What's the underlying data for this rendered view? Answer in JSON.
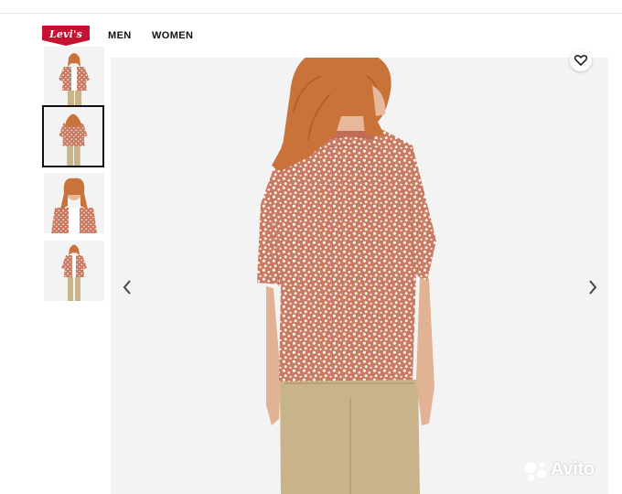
{
  "header": {
    "logo_text": "Levi's",
    "nav": [
      "MEN",
      "WOMEN"
    ]
  },
  "gallery": {
    "thumbnails": [
      {
        "view": "front-open",
        "selected": false
      },
      {
        "view": "back",
        "selected": true
      },
      {
        "view": "front-close",
        "selected": false
      },
      {
        "view": "full-front",
        "selected": false
      }
    ],
    "main_view": "back",
    "prev_icon": "chevron-left-icon",
    "next_icon": "chevron-right-icon",
    "favorite_icon": "heart-icon"
  },
  "watermark": {
    "text": "Avito"
  },
  "colors": {
    "brand_red": "#c41230",
    "shirt": "#c87a62",
    "dots": "#fbf2ea",
    "hair": "#c9733a",
    "pants": "#c9b38a",
    "skin": "#e7b89b",
    "background": "#f3f3f3"
  }
}
